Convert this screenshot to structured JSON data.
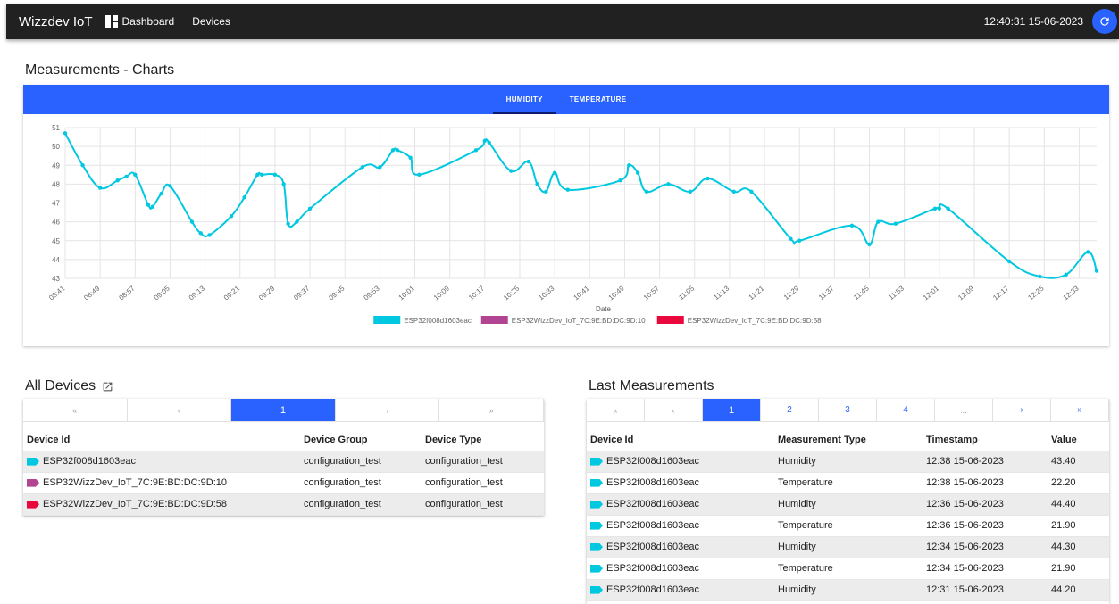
{
  "nav": {
    "brand": "Wizzdev IoT",
    "dashboard_label": "Dashboard",
    "devices_label": "Devices",
    "clock": "12:40:31 15-06-2023"
  },
  "charts_section": {
    "title": "Measurements - Charts",
    "tabs": [
      "HUMIDITY",
      "TEMPERATURE"
    ],
    "active_tab": "HUMIDITY"
  },
  "chart_data": {
    "type": "line",
    "xlabel": "Date",
    "ylabel": "",
    "ylim": [
      43,
      51
    ],
    "yticks": [
      43,
      44,
      45,
      46,
      47,
      48,
      49,
      50,
      51
    ],
    "xticks": [
      "08:41",
      "08:49",
      "08:57",
      "09:05",
      "09:13",
      "09:21",
      "09:29",
      "09:37",
      "09:45",
      "09:53",
      "10:01",
      "10:09",
      "10:17",
      "10:25",
      "10:33",
      "10:41",
      "10:49",
      "10:57",
      "11:05",
      "11:13",
      "11:21",
      "11:29",
      "11:37",
      "11:45",
      "11:53",
      "12:01",
      "12:09",
      "12:17",
      "12:25",
      "12:33"
    ],
    "grid": true,
    "legend_position": "bottom",
    "legend": [
      {
        "name": "ESP32f008d1603eac",
        "color": "#00c8e0"
      },
      {
        "name": "ESP32WizzDev_IoT_7C:9E:BD:DC:9D:10",
        "color": "#b24592"
      },
      {
        "name": "ESP32WizzDev_IoT_7C:9E:BD:DC:9D:58",
        "color": "#e8083e"
      }
    ],
    "series": [
      {
        "name": "ESP32f008d1603eac",
        "x": [
          "08:41",
          "08:45",
          "08:49",
          "08:53",
          "08:55",
          "08:57",
          "09:00",
          "09:01",
          "09:03",
          "09:05",
          "09:10",
          "09:12",
          "09:14",
          "09:19",
          "09:22",
          "09:25",
          "09:26",
          "09:29",
          "09:31",
          "09:32",
          "09:34",
          "09:37",
          "09:49",
          "09:53",
          "09:56",
          "09:57",
          "10:00",
          "10:02",
          "10:15",
          "10:17",
          "10:18",
          "10:23",
          "10:27",
          "10:29",
          "10:31",
          "10:33",
          "10:36",
          "10:48",
          "10:50",
          "10:52",
          "10:54",
          "10:59",
          "11:04",
          "11:08",
          "11:14",
          "11:18",
          "11:27",
          "11:29",
          "11:41",
          "11:45",
          "11:47",
          "11:51",
          "12:00",
          "12:01",
          "12:03",
          "12:17",
          "12:24",
          "12:30",
          "12:35",
          "12:37"
        ],
        "y": [
          50.7,
          49.0,
          47.8,
          48.2,
          48.4,
          48.5,
          46.9,
          46.8,
          47.5,
          47.9,
          46.0,
          45.4,
          45.3,
          46.3,
          47.3,
          48.5,
          48.5,
          48.5,
          48.0,
          45.9,
          46.0,
          46.7,
          48.9,
          48.9,
          49.8,
          49.8,
          49.4,
          48.5,
          49.8,
          50.3,
          50.2,
          48.7,
          49.2,
          48.0,
          47.6,
          48.6,
          47.7,
          48.2,
          49.0,
          48.6,
          47.6,
          48.0,
          47.6,
          48.3,
          47.6,
          47.6,
          45.1,
          45.0,
          45.8,
          44.8,
          46.0,
          45.9,
          46.7,
          46.7,
          46.7,
          43.9,
          43.1,
          43.2,
          44.4,
          43.4
        ]
      }
    ]
  },
  "devices_panel": {
    "title": "All Devices",
    "pagination": [
      "«",
      "‹",
      "1",
      "›",
      "»"
    ],
    "active_page": "1",
    "columns": [
      "Device Id",
      "Device Group",
      "Device Type"
    ],
    "rows": [
      {
        "color": "#00c8e0",
        "id": "ESP32f008d1603eac",
        "group": "configuration_test",
        "type": "configuration_test"
      },
      {
        "color": "#b24592",
        "id": "ESP32WizzDev_IoT_7C:9E:BD:DC:9D:10",
        "group": "configuration_test",
        "type": "configuration_test"
      },
      {
        "color": "#e8083e",
        "id": "ESP32WizzDev_IoT_7C:9E:BD:DC:9D:58",
        "group": "configuration_test",
        "type": "configuration_test"
      }
    ]
  },
  "measurements_panel": {
    "title": "Last Measurements",
    "pagination": [
      "«",
      "‹",
      "1",
      "2",
      "3",
      "4",
      "...",
      "›",
      "»"
    ],
    "active_page": "1",
    "columns": [
      "Device Id",
      "Measurement Type",
      "Timestamp",
      "Value"
    ],
    "rows": [
      {
        "color": "#00c8e0",
        "id": "ESP32f008d1603eac",
        "type": "Humidity",
        "timestamp": "12:38 15-06-2023",
        "value": "43.40"
      },
      {
        "color": "#00c8e0",
        "id": "ESP32f008d1603eac",
        "type": "Temperature",
        "timestamp": "12:38 15-06-2023",
        "value": "22.20"
      },
      {
        "color": "#00c8e0",
        "id": "ESP32f008d1603eac",
        "type": "Humidity",
        "timestamp": "12:36 15-06-2023",
        "value": "44.40"
      },
      {
        "color": "#00c8e0",
        "id": "ESP32f008d1603eac",
        "type": "Temperature",
        "timestamp": "12:36 15-06-2023",
        "value": "21.90"
      },
      {
        "color": "#00c8e0",
        "id": "ESP32f008d1603eac",
        "type": "Humidity",
        "timestamp": "12:34 15-06-2023",
        "value": "44.30"
      },
      {
        "color": "#00c8e0",
        "id": "ESP32f008d1603eac",
        "type": "Temperature",
        "timestamp": "12:34 15-06-2023",
        "value": "21.90"
      },
      {
        "color": "#00c8e0",
        "id": "ESP32f008d1603eac",
        "type": "Humidity",
        "timestamp": "12:31 15-06-2023",
        "value": "44.20"
      }
    ]
  }
}
